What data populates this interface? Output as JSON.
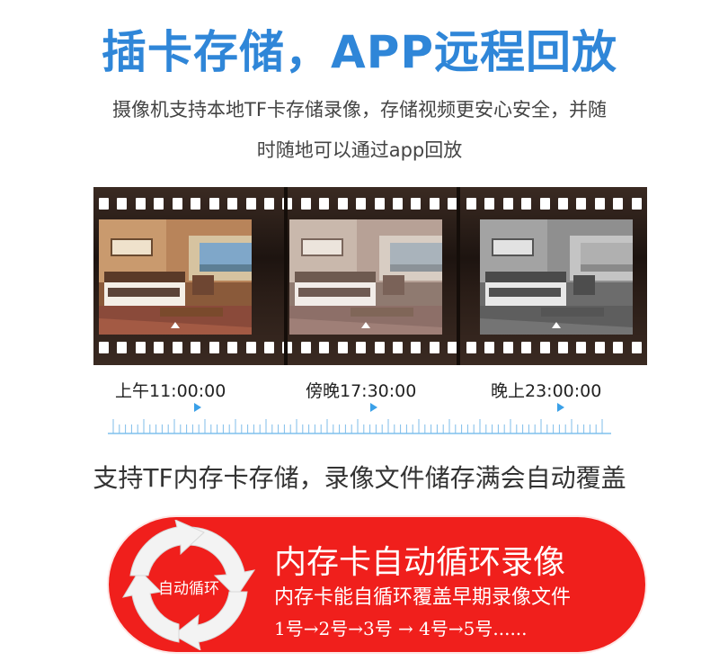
{
  "header": {
    "title": "插卡存储，APP远程回放",
    "subtitle_line1": "摄像机支持本地TF卡存储录像，存储视频更安心安全，并随",
    "subtitle_line2": "时随地可以通过app回放"
  },
  "film": {
    "frames": [
      {
        "name": "frame-color"
      },
      {
        "name": "frame-faded"
      },
      {
        "name": "frame-grayscale"
      }
    ]
  },
  "timeline": {
    "labels": [
      "上午11:00:00",
      "傍晚17:30:00",
      "晚上23:00:00"
    ],
    "accent_color": "#3aa0e8"
  },
  "caption": "支持TF内存卡存储，录像文件储存满会自动覆盖",
  "banner": {
    "loop_label": "自动循环",
    "title": "内存卡自动循环录像",
    "subtitle": "内存卡能自循环覆盖早期录像文件",
    "sequence": "1号→2号→3号 → 4号→5号......",
    "color": "#f01f1c"
  }
}
